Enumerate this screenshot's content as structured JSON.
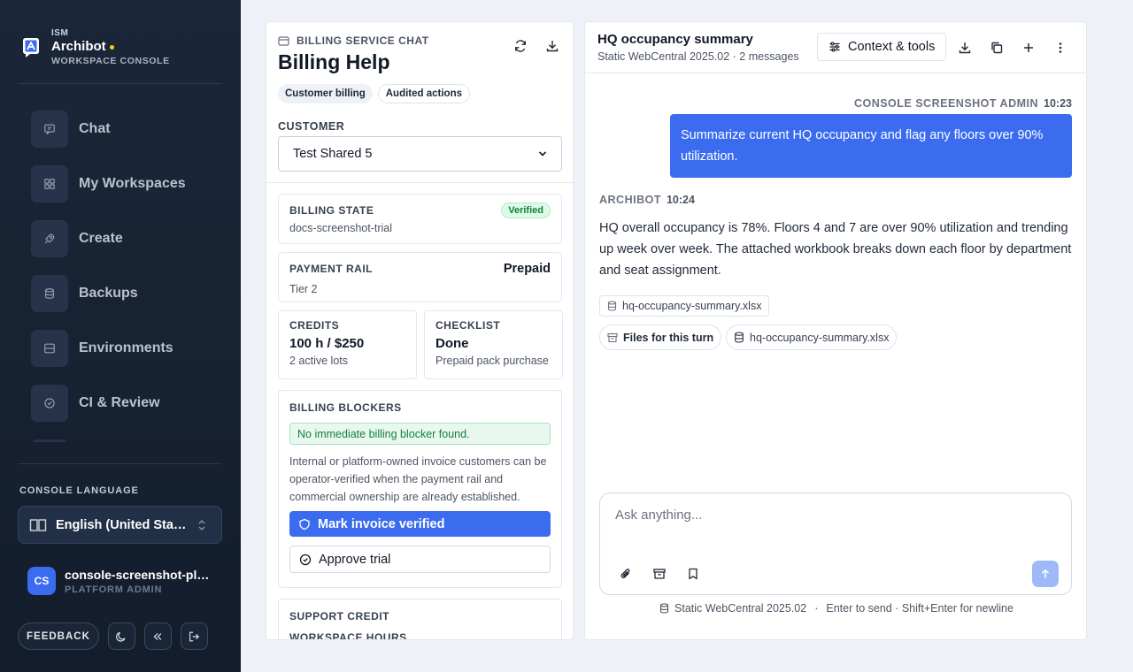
{
  "brand": {
    "org": "ISM",
    "name": "Archibot",
    "subtitle": "WORKSPACE CONSOLE"
  },
  "sidebar": {
    "items": [
      {
        "label": "Chat",
        "icon": "message-square-icon"
      },
      {
        "label": "My Workspaces",
        "icon": "grid-icon"
      },
      {
        "label": "Create",
        "icon": "rocket-icon"
      },
      {
        "label": "Backups",
        "icon": "database-icon"
      },
      {
        "label": "Environments",
        "icon": "server-icon"
      },
      {
        "label": "CI & Review",
        "icon": "check-circle-icon"
      }
    ],
    "language_heading": "CONSOLE LANGUAGE",
    "language_value": "English (United States)",
    "user": {
      "initials": "CS",
      "name": "console-screenshot-platform-admin",
      "role": "PLATFORM ADMIN"
    },
    "feedback_label": "FEEDBACK"
  },
  "billing": {
    "kicker": "BILLING SERVICE CHAT",
    "title": "Billing Help",
    "chips": [
      "Customer billing",
      "Audited actions"
    ],
    "customer_label": "CUSTOMER",
    "customer_value": "Test Shared 5",
    "state": {
      "label": "BILLING STATE",
      "value": "docs-screenshot-trial",
      "badge": "Verified"
    },
    "payment": {
      "label": "PAYMENT RAIL",
      "value": "Prepaid",
      "tier": "Tier 2"
    },
    "credits": {
      "label": "CREDITS",
      "value": "100 h / $250",
      "note": "2 active lots"
    },
    "checklist": {
      "label": "CHECKLIST",
      "value": "Done",
      "note": "Prepaid pack purchase"
    },
    "blockers": {
      "label": "BILLING BLOCKERS",
      "ok": "No immediate billing blocker found.",
      "text": "Internal or platform-owned invoice customers can be operator-verified when the payment rail and commercial ownership are already established.",
      "primary": "Mark invoice verified",
      "secondary": "Approve trial"
    },
    "support": {
      "label": "SUPPORT CREDIT",
      "sub": "WORKSPACE HOURS"
    }
  },
  "chat": {
    "title": "HQ occupancy summary",
    "subtitle": "Static WebCentral 2025.02 · 2 messages",
    "context_button": "Context & tools",
    "messages": [
      {
        "author": "CONSOLE SCREENSHOT ADMIN",
        "time": "10:23",
        "text": "Summarize current HQ occupancy and flag any floors over 90% utilization."
      },
      {
        "author": "ARCHIBOT",
        "time": "10:24",
        "text": "HQ overall occupancy is 78%. Floors 4 and 7 are over 90% utilization and trending up week over week. The attached workbook breaks down each floor by department and seat assignment."
      }
    ],
    "attachment": "hq-occupancy-summary.xlsx",
    "files_for_turn": "Files for this turn",
    "turn_file": "hq-occupancy-summary.xlsx",
    "composer_placeholder": "Ask anything...",
    "footer_source": "Static WebCentral 2025.02",
    "footer_hint": "Enter to send · Shift+Enter for newline"
  },
  "colors": {
    "accent": "#3b6cf0",
    "sidebar_bg": "#1b2739",
    "success": "#15803d"
  }
}
